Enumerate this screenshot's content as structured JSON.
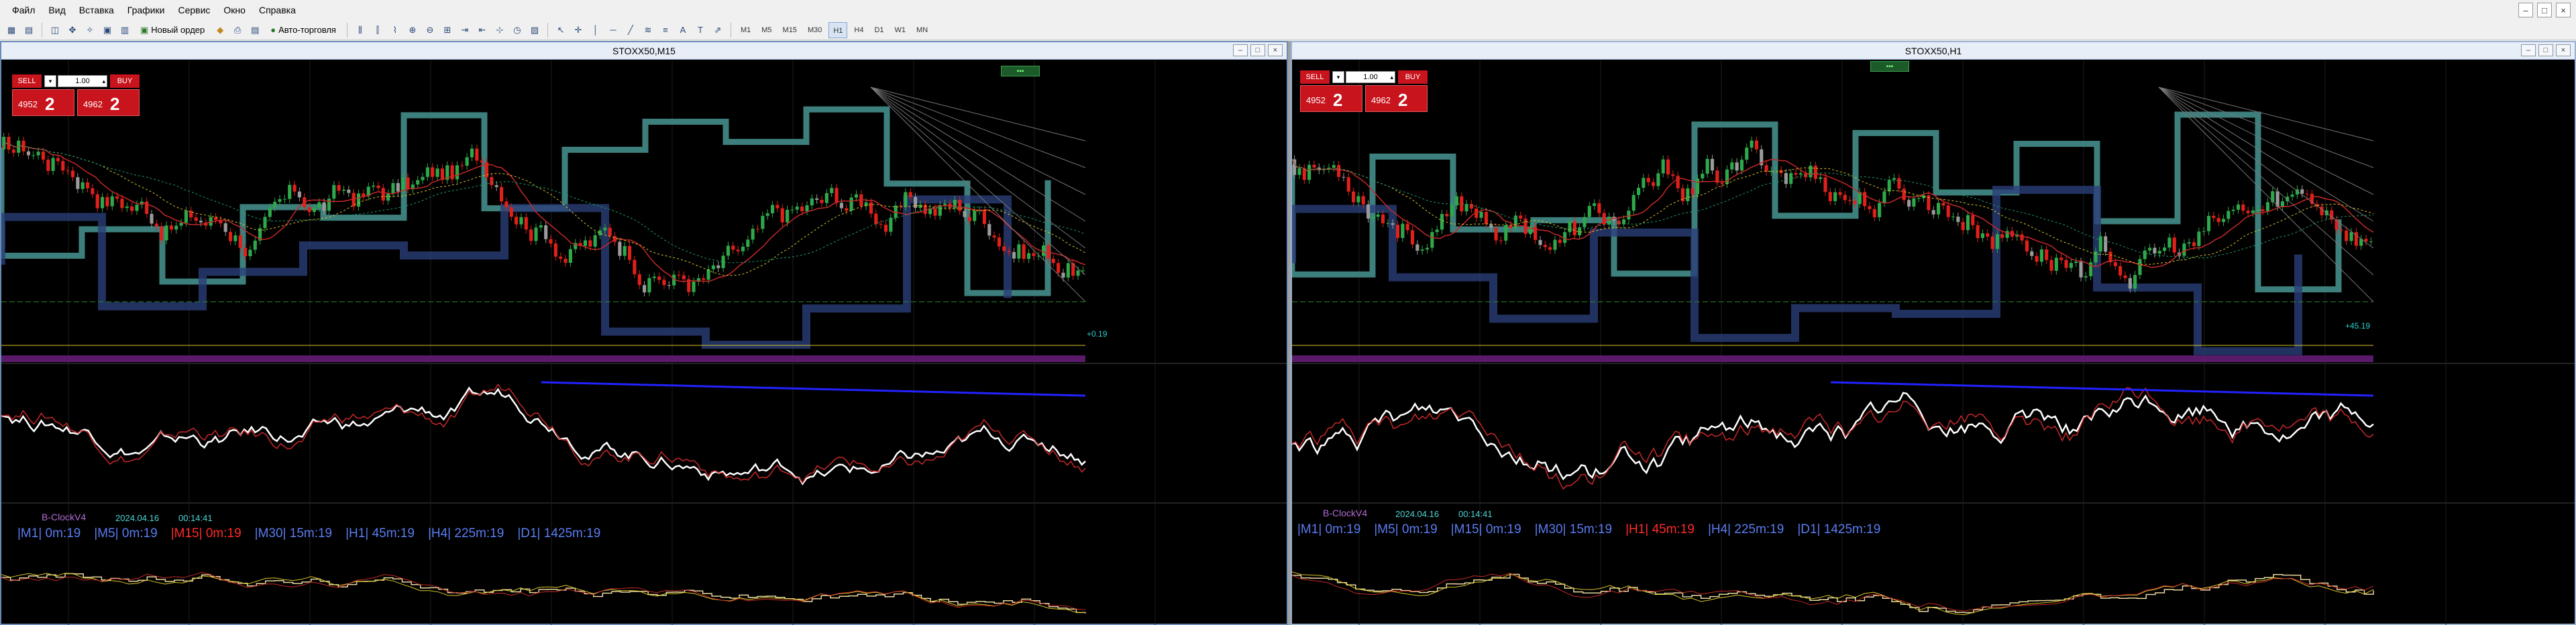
{
  "menu": [
    "Файл",
    "Вид",
    "Вставка",
    "Графики",
    "Сервис",
    "Окно",
    "Справка"
  ],
  "toolbar": {
    "new_order": "Новый ордер",
    "auto_trading": "Авто-торговля",
    "timeframes": [
      "M1",
      "M5",
      "M15",
      "M30",
      "H1",
      "H4",
      "D1",
      "W1",
      "MN"
    ],
    "active_timeframe": "H1"
  },
  "window_controls": [
    "–",
    "□",
    "×"
  ],
  "charts": [
    {
      "title": "STOXX50,M15",
      "one_click": {
        "sell": "SELL",
        "buy": "BUY",
        "lot": "1.00",
        "sell_small": "4952",
        "sell_big": "2",
        "buy_small": "4962",
        "buy_big": "2"
      },
      "indicator_name": "B-ClockV4",
      "date": "2024.04.16",
      "time": "00:14:41",
      "clock": [
        {
          "text": "|M1| 0m:19",
          "hot": false
        },
        {
          "text": "|M5| 0m:19",
          "hot": false
        },
        {
          "text": "|M15| 0m:19",
          "hot": true
        },
        {
          "text": "|M30| 15m:19",
          "hot": false
        },
        {
          "text": "|H1| 45m:19",
          "hot": false
        },
        {
          "text": "|H4| 225m:19",
          "hot": false
        },
        {
          "text": "|D1| 1425m:19",
          "hot": false
        }
      ],
      "profit_label": "+0.19"
    },
    {
      "title": "STOXX50,H1",
      "one_click": {
        "sell": "SELL",
        "buy": "BUY",
        "lot": "1.00",
        "sell_small": "4952",
        "sell_big": "2",
        "buy_small": "4962",
        "buy_big": "2"
      },
      "indicator_name": "B-ClockV4",
      "date": "2024.04.16",
      "time": "00:14:41",
      "clock": [
        {
          "text": "|M1| 0m:19",
          "hot": false
        },
        {
          "text": "|M5| 0m:19",
          "hot": false
        },
        {
          "text": "|M15| 0m:19",
          "hot": false
        },
        {
          "text": "|M30| 15m:19",
          "hot": false
        },
        {
          "text": "|H1| 45m:19",
          "hot": true
        },
        {
          "text": "|H4| 225m:19",
          "hot": false
        },
        {
          "text": "|D1| 1425m:19",
          "hot": false
        }
      ],
      "profit_label": "+45.19"
    }
  ]
}
